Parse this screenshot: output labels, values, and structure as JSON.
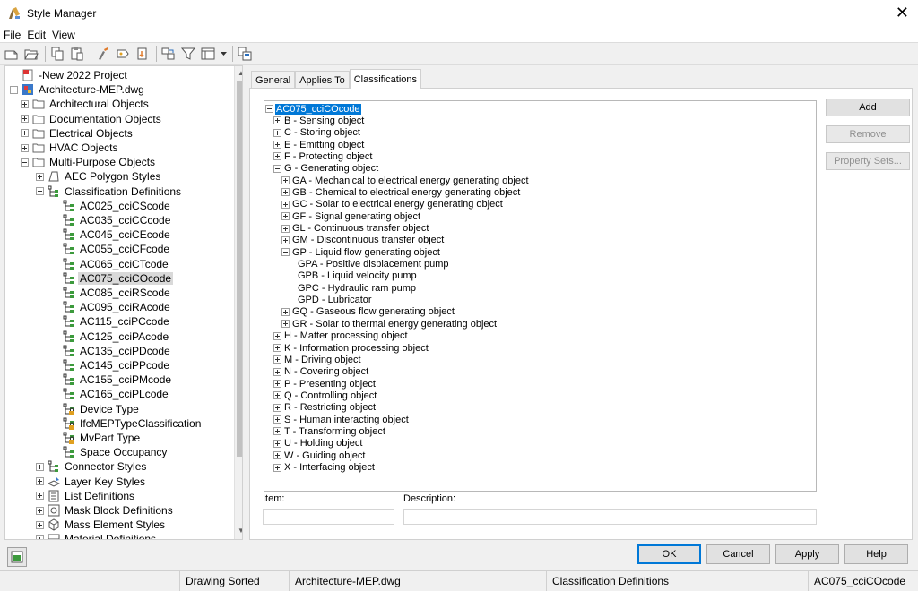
{
  "window": {
    "title": "Style Manager"
  },
  "menu": [
    "File",
    "Edit",
    "View"
  ],
  "toolbar": [
    "new-drawing-icon",
    "open-drawing-icon",
    "copy-icon",
    "paste-icon",
    "purge-icon",
    "edit-style-icon",
    "set-from-icon",
    "sort-icon",
    "filter-icon",
    "view-icon",
    "dropdown-icon",
    "toggle-view-icon"
  ],
  "left_tree": [
    {
      "label": "-New 2022 Project",
      "level": 0,
      "exp": "none",
      "icon": "project-icon"
    },
    {
      "label": "Architecture-MEP.dwg",
      "level": 0,
      "exp": "minus",
      "icon": "drawing-icon"
    },
    {
      "label": "Architectural Objects",
      "level": 1,
      "exp": "plus",
      "icon": "folder-icon"
    },
    {
      "label": "Documentation Objects",
      "level": 1,
      "exp": "plus",
      "icon": "folder-icon"
    },
    {
      "label": "Electrical Objects",
      "level": 1,
      "exp": "plus",
      "icon": "folder-icon"
    },
    {
      "label": "HVAC Objects",
      "level": 1,
      "exp": "plus",
      "icon": "folder-icon"
    },
    {
      "label": "Multi-Purpose Objects",
      "level": 1,
      "exp": "minus",
      "icon": "folder-icon"
    },
    {
      "label": "AEC Polygon Styles",
      "level": 2,
      "exp": "plus",
      "icon": "polygon-icon"
    },
    {
      "label": "Classification Definitions",
      "level": 2,
      "exp": "minus",
      "icon": "classification-icon"
    },
    {
      "label": "AC025_cciCScode",
      "level": 3,
      "exp": "none",
      "icon": "classification-icon"
    },
    {
      "label": "AC035_cciCCcode",
      "level": 3,
      "exp": "none",
      "icon": "classification-icon"
    },
    {
      "label": "AC045_cciCEcode",
      "level": 3,
      "exp": "none",
      "icon": "classification-icon"
    },
    {
      "label": "AC055_cciCFcode",
      "level": 3,
      "exp": "none",
      "icon": "classification-icon"
    },
    {
      "label": "AC065_cciCTcode",
      "level": 3,
      "exp": "none",
      "icon": "classification-icon"
    },
    {
      "label": "AC075_cciCOcode",
      "level": 3,
      "exp": "none",
      "icon": "classification-icon",
      "selected": true
    },
    {
      "label": "AC085_cciRScode",
      "level": 3,
      "exp": "none",
      "icon": "classification-icon"
    },
    {
      "label": "AC095_cciRAcode",
      "level": 3,
      "exp": "none",
      "icon": "classification-icon"
    },
    {
      "label": "AC115_cciPCcode",
      "level": 3,
      "exp": "none",
      "icon": "classification-icon"
    },
    {
      "label": "AC125_cciPAcode",
      "level": 3,
      "exp": "none",
      "icon": "classification-icon"
    },
    {
      "label": "AC135_cciPDcode",
      "level": 3,
      "exp": "none",
      "icon": "classification-icon"
    },
    {
      "label": "AC145_cciPPcode",
      "level": 3,
      "exp": "none",
      "icon": "classification-icon"
    },
    {
      "label": "AC155_cciPMcode",
      "level": 3,
      "exp": "none",
      "icon": "classification-icon"
    },
    {
      "label": "AC165_cciPLcode",
      "level": 3,
      "exp": "none",
      "icon": "classification-icon"
    },
    {
      "label": "Device Type",
      "level": 3,
      "exp": "none",
      "icon": "locked-classification-icon"
    },
    {
      "label": "IfcMEPTypeClassification",
      "level": 3,
      "exp": "none",
      "icon": "locked-classification-icon"
    },
    {
      "label": "MvPart Type",
      "level": 3,
      "exp": "none",
      "icon": "locked-classification-icon"
    },
    {
      "label": "Space Occupancy",
      "level": 3,
      "exp": "none",
      "icon": "classification-icon"
    },
    {
      "label": "Connector Styles",
      "level": 2,
      "exp": "plus",
      "icon": "classification-icon"
    },
    {
      "label": "Layer Key Styles",
      "level": 2,
      "exp": "plus",
      "icon": "layer-key-icon"
    },
    {
      "label": "List Definitions",
      "level": 2,
      "exp": "plus",
      "icon": "list-icon"
    },
    {
      "label": "Mask Block Definitions",
      "level": 2,
      "exp": "plus",
      "icon": "mask-block-icon"
    },
    {
      "label": "Mass Element Styles",
      "level": 2,
      "exp": "plus",
      "icon": "mass-element-icon"
    },
    {
      "label": "Material Definitions",
      "level": 2,
      "exp": "plus",
      "icon": "material-icon"
    }
  ],
  "tabs": [
    {
      "label": "General",
      "active": false
    },
    {
      "label": "Applies To",
      "active": false
    },
    {
      "label": "Classifications",
      "active": true
    }
  ],
  "classification_tree": [
    {
      "label": "AC075_cciCOcode",
      "level": 0,
      "exp": "minus",
      "highlight": true
    },
    {
      "label": "B - Sensing object",
      "level": 1,
      "exp": "plus"
    },
    {
      "label": "C - Storing object",
      "level": 1,
      "exp": "plus"
    },
    {
      "label": "E - Emitting object",
      "level": 1,
      "exp": "plus"
    },
    {
      "label": "F - Protecting object",
      "level": 1,
      "exp": "plus"
    },
    {
      "label": "G - Generating object",
      "level": 1,
      "exp": "minus"
    },
    {
      "label": "GA - Mechanical to electrical energy generating object",
      "level": 2,
      "exp": "plus"
    },
    {
      "label": "GB - Chemical to electrical energy generating object",
      "level": 2,
      "exp": "plus"
    },
    {
      "label": "GC - Solar to electrical energy generating object",
      "level": 2,
      "exp": "plus"
    },
    {
      "label": "GF - Signal generating object",
      "level": 2,
      "exp": "plus"
    },
    {
      "label": "GL - Continuous transfer object",
      "level": 2,
      "exp": "plus"
    },
    {
      "label": "GM - Discontinuous transfer object",
      "level": 2,
      "exp": "plus"
    },
    {
      "label": "GP - Liquid flow generating object",
      "level": 2,
      "exp": "minus"
    },
    {
      "label": "GPA - Positive displacement pump",
      "level": 3,
      "exp": "none"
    },
    {
      "label": "GPB - Liquid velocity pump",
      "level": 3,
      "exp": "none"
    },
    {
      "label": "GPC - Hydraulic ram pump",
      "level": 3,
      "exp": "none"
    },
    {
      "label": "GPD - Lubricator",
      "level": 3,
      "exp": "none"
    },
    {
      "label": "GQ - Gaseous flow generating object",
      "level": 2,
      "exp": "plus"
    },
    {
      "label": "GR - Solar to thermal energy generating object",
      "level": 2,
      "exp": "plus"
    },
    {
      "label": "H - Matter processing object",
      "level": 1,
      "exp": "plus"
    },
    {
      "label": "K - Information processing object",
      "level": 1,
      "exp": "plus"
    },
    {
      "label": "M - Driving object",
      "level": 1,
      "exp": "plus"
    },
    {
      "label": "N - Covering object",
      "level": 1,
      "exp": "plus"
    },
    {
      "label": "P - Presenting object",
      "level": 1,
      "exp": "plus"
    },
    {
      "label": "Q - Controlling object",
      "level": 1,
      "exp": "plus"
    },
    {
      "label": "R - Restricting object",
      "level": 1,
      "exp": "plus"
    },
    {
      "label": "S - Human interacting object",
      "level": 1,
      "exp": "plus"
    },
    {
      "label": "T - Transforming object",
      "level": 1,
      "exp": "plus"
    },
    {
      "label": "U - Holding object",
      "level": 1,
      "exp": "plus"
    },
    {
      "label": "W - Guiding object",
      "level": 1,
      "exp": "plus"
    },
    {
      "label": "X - Interfacing object",
      "level": 1,
      "exp": "plus"
    }
  ],
  "side_buttons": {
    "add": "Add",
    "remove": "Remove",
    "property_sets": "Property Sets..."
  },
  "fields": {
    "item_label": "Item:",
    "item_value": "",
    "description_label": "Description:",
    "description_value": ""
  },
  "dialog_buttons": {
    "ok": "OK",
    "cancel": "Cancel",
    "apply": "Apply",
    "help": "Help"
  },
  "status": {
    "sort": "Drawing Sorted",
    "drawing": "Architecture-MEP.dwg",
    "category": "Classification Definitions",
    "style": "AC075_cciCOcode"
  },
  "colors": {
    "accent": "#0078d7",
    "selection_gray": "#d9d9d9",
    "folder": "#e8c46a"
  }
}
